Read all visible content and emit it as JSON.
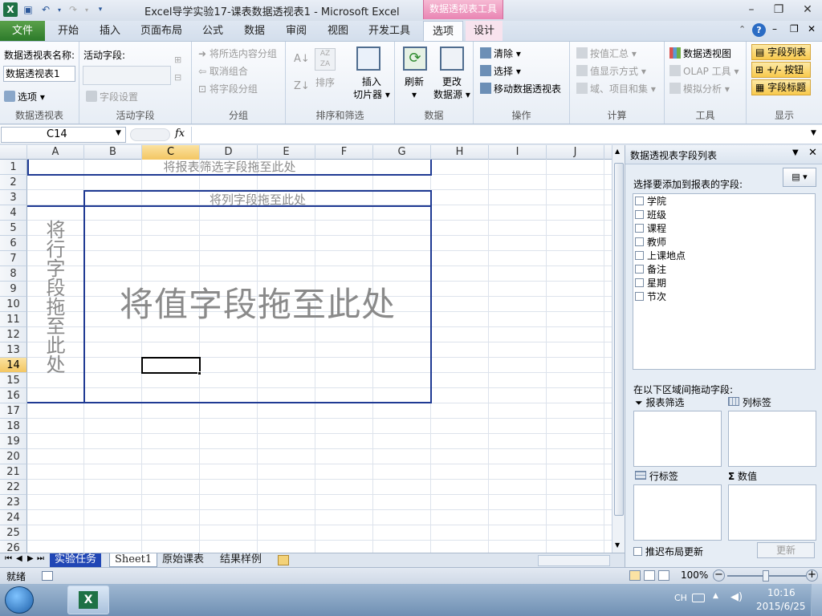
{
  "window": {
    "title": "Excel导学实验17-课表数据透视表1  -  Microsoft Excel",
    "context_tab_title": "数据透视表工具"
  },
  "tabs": [
    "文件",
    "开始",
    "插入",
    "页面布局",
    "公式",
    "数据",
    "审阅",
    "视图",
    "开发工具",
    "选项",
    "设计"
  ],
  "ribbon": {
    "pivot": {
      "name_label": "数据透视表名称:",
      "name_value": "数据透视表1",
      "options": "选项",
      "group": "数据透视表"
    },
    "active_field": {
      "label": "活动字段:",
      "settings": "字段设置",
      "group": "活动字段"
    },
    "grouping": {
      "group_selection": "将所选内容分组",
      "ungroup": "取消组合",
      "group_field": "将字段分组",
      "group": "分组"
    },
    "sort": {
      "sort": "排序",
      "insert_slicer_1": "插入",
      "insert_slicer_2": "切片器",
      "group": "排序和筛选"
    },
    "data": {
      "refresh": "刷新",
      "change_1": "更改",
      "change_2": "数据源",
      "group": "数据"
    },
    "actions": {
      "clear": "清除",
      "select": "选择",
      "move": "移动数据透视表",
      "group": "操作"
    },
    "calc": {
      "summarize": "按值汇总",
      "show_as": "值显示方式",
      "fields_items": "域、项目和集",
      "group": "计算"
    },
    "tools": {
      "pivot_chart": "数据透视图",
      "olap": "OLAP 工具",
      "whatif": "模拟分析",
      "group": "工具"
    },
    "show": {
      "field_list": "字段列表",
      "buttons": "+/- 按钮",
      "headers": "字段标题",
      "group": "显示"
    }
  },
  "formula_bar": {
    "name_box": "C14",
    "fx": "fx",
    "value": ""
  },
  "columns": [
    "A",
    "B",
    "C",
    "D",
    "E",
    "F",
    "G",
    "H",
    "I",
    "J"
  ],
  "rows": [
    "1",
    "2",
    "3",
    "4",
    "5",
    "6",
    "7",
    "8",
    "9",
    "10",
    "11",
    "12",
    "13",
    "14",
    "15",
    "16",
    "17",
    "18",
    "19",
    "20",
    "21",
    "22",
    "23",
    "24",
    "25",
    "26"
  ],
  "pivot_area": {
    "filter": "将报表筛选字段拖至此处",
    "columns": "将列字段拖至此处",
    "rows": "将行字段拖至此处",
    "values": "将值字段拖至此处"
  },
  "sheet_tabs": [
    "实验任务",
    "Sheet1",
    "原始课表",
    "结果样例"
  ],
  "status": {
    "ready": "就绪",
    "zoom": "100%"
  },
  "field_list": {
    "title": "数据透视表字段列表",
    "choose": "选择要添加到报表的字段:",
    "fields": [
      "学院",
      "班级",
      "课程",
      "教师",
      "上课地点",
      "备注",
      "星期",
      "节次"
    ],
    "drag_label": "在以下区域间拖动字段:",
    "areas": {
      "filter": "报表筛选",
      "columns": "列标签",
      "rows": "行标签",
      "values": "数值"
    },
    "defer": "推迟布局更新",
    "update": "更新"
  },
  "taskbar": {
    "lang": "CH",
    "time": "10:16",
    "date": "2015/6/25"
  }
}
